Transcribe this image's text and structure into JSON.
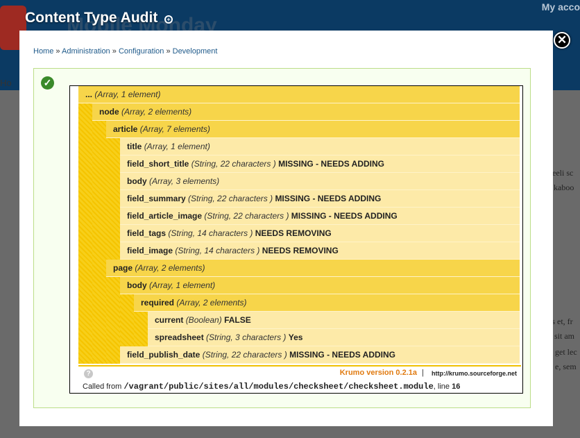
{
  "background": {
    "site_name": "Mobile Monday",
    "account_link": "My acco",
    "crumb_start": "Ho",
    "right_text": [
      "deeli sc",
      "kaboo",
      "es et, fr",
      "n sit am",
      "get lec",
      "e, sem"
    ]
  },
  "overlay": {
    "title": "Content Type Audit",
    "title_icon": "gear-small-icon",
    "close_icon": "close-icon"
  },
  "breadcrumb": {
    "items": [
      "Home",
      "Administration",
      "Configuration",
      "Development"
    ],
    "separator": "»"
  },
  "status": {
    "icon": "checkmark-icon",
    "color": "#3a8a2a"
  },
  "krumo": {
    "rows": [
      {
        "key": "...",
        "type": "(Array, 1 element)",
        "value": ""
      },
      {
        "key": "node",
        "type": "(Array, 2 elements)",
        "value": ""
      },
      {
        "key": "article",
        "type": "(Array, 7 elements)",
        "value": ""
      },
      {
        "key": "title",
        "type": "(Array, 1 element)",
        "value": ""
      },
      {
        "key": "field_short_title",
        "type": "(String, 22 characters )",
        "value": "MISSING - NEEDS ADDING"
      },
      {
        "key": "body",
        "type": "(Array, 3 elements)",
        "value": ""
      },
      {
        "key": "field_summary",
        "type": "(String, 22 characters )",
        "value": "MISSING - NEEDS ADDING"
      },
      {
        "key": "field_article_image",
        "type": "(String, 22 characters )",
        "value": "MISSING - NEEDS ADDING"
      },
      {
        "key": "field_tags",
        "type": "(String, 14 characters )",
        "value": "NEEDS REMOVING"
      },
      {
        "key": "field_image",
        "type": "(String, 14 characters )",
        "value": "NEEDS REMOVING"
      },
      {
        "key": "page",
        "type": "(Array, 2 elements)",
        "value": ""
      },
      {
        "key": "body",
        "type": "(Array, 1 element)",
        "value": ""
      },
      {
        "key": "required",
        "type": "(Array, 2 elements)",
        "value": ""
      },
      {
        "key": "current",
        "type": "(Boolean)",
        "value": "FALSE"
      },
      {
        "key": "spreadsheet",
        "type": "(String, 3 characters )",
        "value": "Yes"
      },
      {
        "key": "field_publish_date",
        "type": "(String, 22 characters )",
        "value": "MISSING - NEEDS ADDING"
      }
    ],
    "version_label": "Krumo version 0.2.1a",
    "version_sep": "|",
    "url": "http://krumo.sourceforge.net",
    "help_icon": "question-icon",
    "called_from_label": "Called from",
    "called_from_path": "/vagrant/public/sites/all/modules/checksheet/checksheet.module",
    "line_label": ", line",
    "line_number": "16"
  }
}
